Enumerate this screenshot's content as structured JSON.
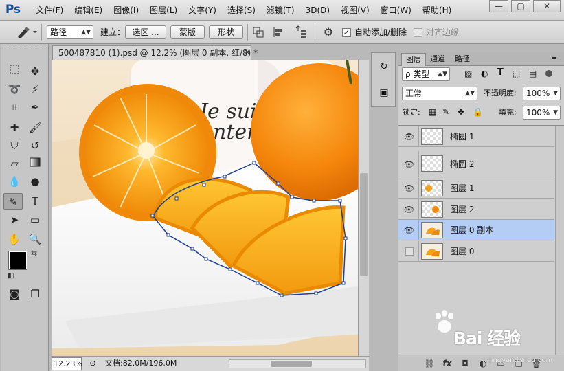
{
  "app": {
    "logo": "Ps"
  },
  "menu": [
    "文件(F)",
    "编辑(E)",
    "图像(I)",
    "图层(L)",
    "文字(Y)",
    "选择(S)",
    "滤镜(T)",
    "3D(D)",
    "视图(V)",
    "窗口(W)",
    "帮助(H)"
  ],
  "window_controls": {
    "minimize": "—",
    "restore": "▢",
    "close": "✕"
  },
  "options": {
    "tool_mode": "路径",
    "build_label": "建立：",
    "selection_btn": "选区 ...",
    "mask_btn": "蒙版",
    "shape_btn": "形状",
    "auto_add_delete": "自动添加/删除",
    "align_edges": "对齐边缘",
    "auto_add_checked": "✓"
  },
  "document": {
    "tab_title": "500487810 (1).psd @ 12.2% (图层 0 副本, 红/8) *",
    "close": "✕",
    "canvas_text_1": "Je suis",
    "canvas_text_2": "ntente"
  },
  "status": {
    "zoom": "12.23%",
    "doc_info": "文档:82.0M/196.0M"
  },
  "layers_panel": {
    "tabs": [
      "图层",
      "通道",
      "路径"
    ],
    "filter_kind": "ρ 类型",
    "blend_mode": "正常",
    "opacity_label": "不透明度:",
    "opacity_value": "100%",
    "lock_label": "锁定:",
    "fill_label": "填充:",
    "fill_value": "100%",
    "layers": [
      {
        "name": "椭圆 1",
        "visible": true,
        "selected": false
      },
      {
        "name": "椭圆 2",
        "visible": true,
        "selected": false
      },
      {
        "name": "图层 1",
        "visible": true,
        "selected": false
      },
      {
        "name": "图层 2",
        "visible": true,
        "selected": false
      },
      {
        "name": "图层 0 副本",
        "visible": true,
        "selected": true
      },
      {
        "name": "图层 0",
        "visible": false,
        "selected": false
      }
    ],
    "bottom_fx": "fx"
  },
  "watermark": {
    "brand": "Bai 经验",
    "url": "jingyan.baidu.com"
  }
}
